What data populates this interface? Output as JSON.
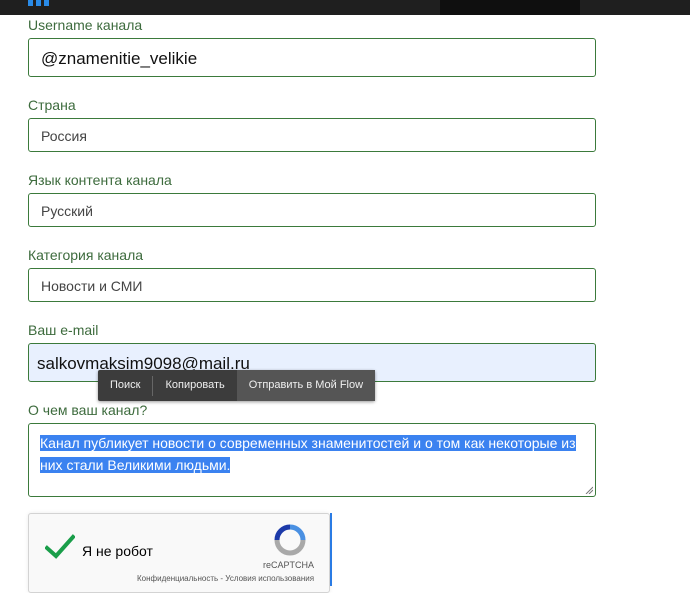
{
  "form": {
    "username": {
      "label": "Username канала",
      "value": "@znamenitie_velikie"
    },
    "country": {
      "label": "Страна",
      "value": "Россия"
    },
    "language": {
      "label": "Язык контента канала",
      "value": "Русский"
    },
    "category": {
      "label": "Категория канала",
      "value": "Новости и СМИ"
    },
    "email": {
      "label": "Ваш e-mail",
      "value": "salkovmaksim9098@mail.ru"
    },
    "about": {
      "label": "О чем ваш канал?",
      "line1": "Канал публикует новости  о современных знаменитостей и о том как некоторые из",
      "line2": "них  стали Великими людьми."
    }
  },
  "context_menu": {
    "search": "Поиск",
    "copy": "Копировать",
    "send_flow": "Отправить в Мой Flow"
  },
  "captcha": {
    "label": "Я не робот",
    "brand": "reCAPTCHA",
    "privacy": "Конфиденциальность",
    "separator": " - ",
    "terms": "Условия использования"
  },
  "colors": {
    "field_border": "#3b7a3b",
    "label_text": "#3d6b3d",
    "selection": "#3b82f0",
    "autofill_bg": "#e8f0fe",
    "checkmark": "#1a9e4a"
  }
}
